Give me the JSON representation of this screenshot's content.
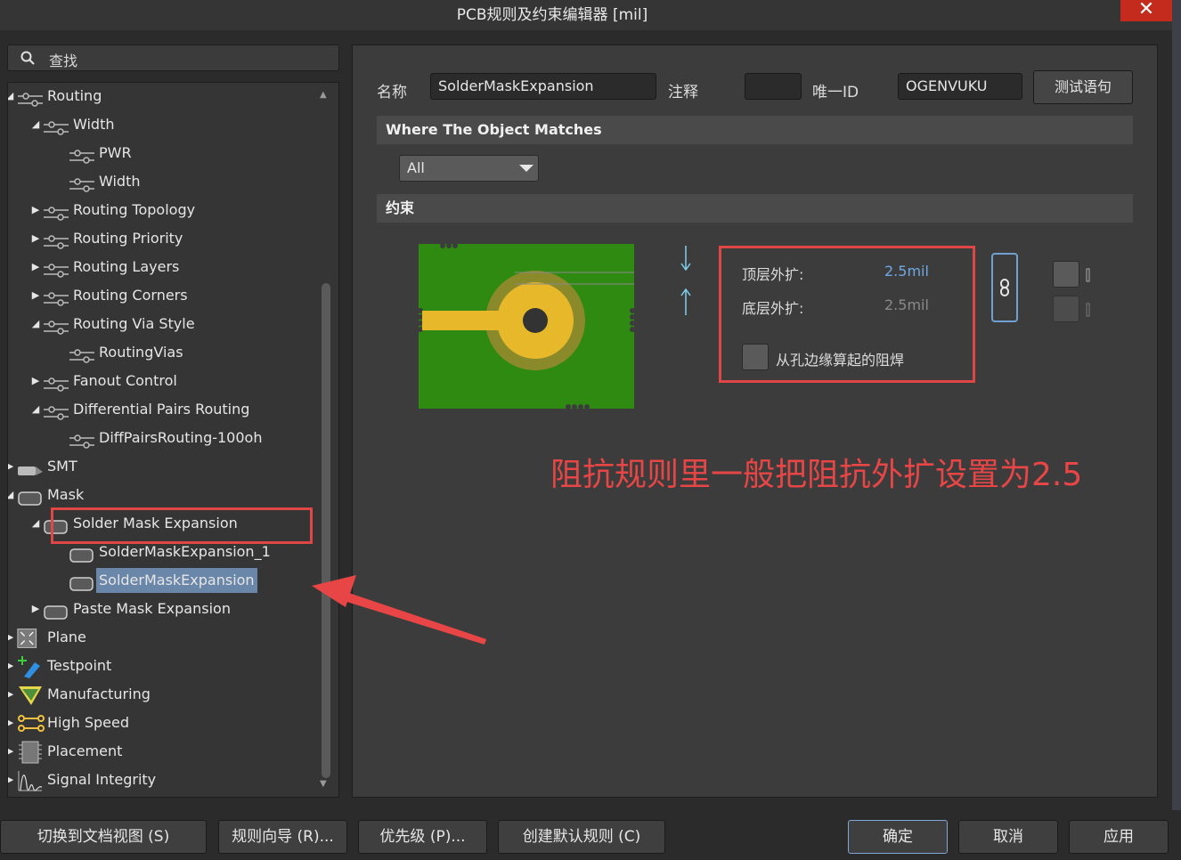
{
  "window": {
    "title": "PCB规则及约束编辑器 [mil]",
    "close_glyph": "✕"
  },
  "search": {
    "label": "查找"
  },
  "tree": [
    {
      "id": "routing",
      "label": "Routing",
      "level": 1,
      "toggle": "expanded",
      "icon": "rule-icon"
    },
    {
      "id": "width",
      "label": "Width",
      "level": 2,
      "toggle": "expanded",
      "icon": "rule-icon"
    },
    {
      "id": "pwr",
      "label": "PWR",
      "level": 3,
      "toggle": "none",
      "icon": "rule-icon"
    },
    {
      "id": "width-rule",
      "label": "Width",
      "level": 3,
      "toggle": "none",
      "icon": "rule-icon"
    },
    {
      "id": "routing-topology",
      "label": "Routing Topology",
      "level": 2,
      "toggle": "collapsed",
      "icon": "rule-icon"
    },
    {
      "id": "routing-priority",
      "label": "Routing Priority",
      "level": 2,
      "toggle": "collapsed",
      "icon": "rule-icon"
    },
    {
      "id": "routing-layers",
      "label": "Routing Layers",
      "level": 2,
      "toggle": "collapsed",
      "icon": "rule-icon"
    },
    {
      "id": "routing-corners",
      "label": "Routing Corners",
      "level": 2,
      "toggle": "collapsed",
      "icon": "rule-icon"
    },
    {
      "id": "routing-via-style",
      "label": "Routing Via Style",
      "level": 2,
      "toggle": "expanded",
      "icon": "rule-icon"
    },
    {
      "id": "routingvias",
      "label": "RoutingVias",
      "level": 3,
      "toggle": "none",
      "icon": "rule-icon"
    },
    {
      "id": "fanout-control",
      "label": "Fanout Control",
      "level": 2,
      "toggle": "collapsed",
      "icon": "rule-icon"
    },
    {
      "id": "diff-pairs-routing",
      "label": "Differential Pairs Routing",
      "level": 2,
      "toggle": "expanded",
      "icon": "rule-icon"
    },
    {
      "id": "diffpairsrouting-100oh",
      "label": "DiffPairsRouting-100oh",
      "level": 3,
      "toggle": "none",
      "icon": "rule-icon"
    },
    {
      "id": "smt",
      "label": "SMT",
      "level": 1,
      "toggle": "collapsed",
      "icon": "smt-icon"
    },
    {
      "id": "mask",
      "label": "Mask",
      "level": 1,
      "toggle": "expanded",
      "icon": "mask-icon"
    },
    {
      "id": "solder-mask-expansion",
      "label": "Solder Mask Expansion",
      "level": 2,
      "toggle": "expanded",
      "icon": "mask-icon"
    },
    {
      "id": "soldermaskexpansion-1",
      "label": "SolderMaskExpansion_1",
      "level": 3,
      "toggle": "none",
      "icon": "mask-icon"
    },
    {
      "id": "soldermaskexpansion",
      "label": "SolderMaskExpansion",
      "level": 3,
      "toggle": "none",
      "icon": "mask-icon",
      "selected": true
    },
    {
      "id": "paste-mask-expansion",
      "label": "Paste Mask Expansion",
      "level": 2,
      "toggle": "collapsed",
      "icon": "mask-icon"
    },
    {
      "id": "plane",
      "label": "Plane",
      "level": 1,
      "toggle": "collapsed",
      "icon": "plane-icon"
    },
    {
      "id": "testpoint",
      "label": "Testpoint",
      "level": 1,
      "toggle": "collapsed",
      "icon": "testpoint-icon"
    },
    {
      "id": "manufacturing",
      "label": "Manufacturing",
      "level": 1,
      "toggle": "collapsed",
      "icon": "manufacturing-icon"
    },
    {
      "id": "high-speed",
      "label": "High Speed",
      "level": 1,
      "toggle": "collapsed",
      "icon": "high-speed-icon"
    },
    {
      "id": "placement",
      "label": "Placement",
      "level": 1,
      "toggle": "collapsed",
      "icon": "placement-icon"
    },
    {
      "id": "signal-integrity",
      "label": "Signal Integrity",
      "level": 1,
      "toggle": "collapsed",
      "icon": "signal-integrity-icon"
    }
  ],
  "rule": {
    "name_label": "名称",
    "name_value": "SolderMaskExpansion",
    "comment_label": "注释",
    "comment_value": "",
    "uid_label": "唯一ID",
    "uid_value": "OGENVUKU",
    "test_button": "测试语句"
  },
  "match": {
    "section_title": "Where The Object Matches",
    "scope_value": "All"
  },
  "constraints": {
    "section_title": "约束",
    "top_label": "顶层外扩:",
    "top_value": "2.5mil",
    "bottom_label": "底层外扩:",
    "bottom_value": "2.5mil",
    "from_hole_label": "从孔边缘算起的阻焊",
    "from_hole_checked": false,
    "top_color": "#6fa8e0",
    "bottom_color": "#8a8a8a"
  },
  "annotation": {
    "text": "阻抗规则里一般把阻抗外扩设置为2.5",
    "color": "#e84646"
  },
  "footer": {
    "doc_view": "切换到文档视图 (S)",
    "rule_wizard": "规则向导 (R)...",
    "priority": "优先级 (P)...",
    "create_default": "创建默认规则 (C)",
    "ok": "确定",
    "cancel": "取消",
    "apply": "应用"
  }
}
